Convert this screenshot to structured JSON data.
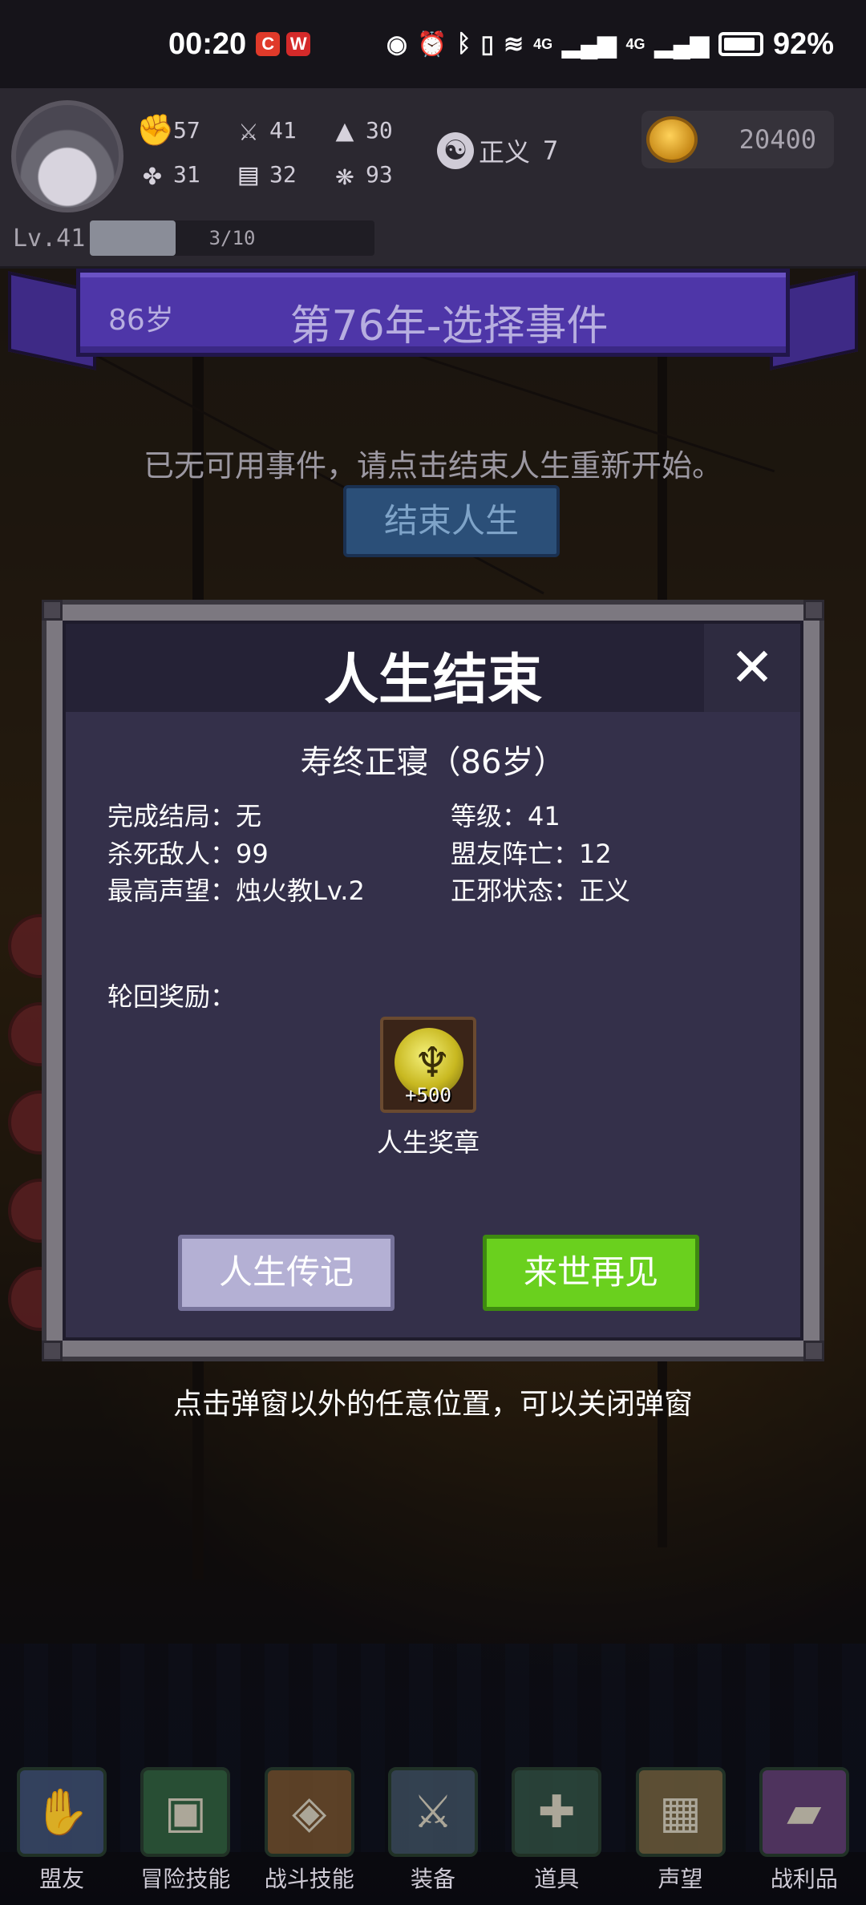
{
  "statusbar": {
    "time": "00:20",
    "badge1": "C",
    "badge2": "W",
    "network1": "4G",
    "network2": "4G",
    "battery_percent": 92,
    "battery_label": "92%"
  },
  "player": {
    "stats": [
      {
        "icon": "fist-icon",
        "glyph": "✊",
        "value": "57"
      },
      {
        "icon": "sword-icon",
        "glyph": "⚔",
        "value": "41"
      },
      {
        "icon": "wizard-hat-icon",
        "glyph": "▲",
        "value": "30"
      },
      {
        "icon": "clover-icon",
        "glyph": "✤",
        "value": "31"
      },
      {
        "icon": "book-icon",
        "glyph": "▤",
        "value": "32"
      },
      {
        "icon": "wings-icon",
        "glyph": "❋",
        "value": "93"
      }
    ],
    "alignment_label": "正义",
    "alignment_value": "7",
    "gold": "20400",
    "level_label": "Lv.41",
    "xp_text": "3/10",
    "xp_fraction": 0.3
  },
  "ribbon": {
    "age": "86岁",
    "title": "第76年-选择事件"
  },
  "main": {
    "no_event_text": "已无可用事件，请点击结束人生重新开始。",
    "end_life_button": "结束人生"
  },
  "modal": {
    "title": "人生结束",
    "close_glyph": "✕",
    "death_text": "寿终正寝（86岁）",
    "info_left": [
      "完成结局：无",
      "杀死敌人：99",
      "最高声望：烛火教Lv.2"
    ],
    "info_right": [
      "等级：41",
      "盟友阵亡：12",
      "正邪状态：正义"
    ],
    "reward_label": "轮回奖励：",
    "reward": {
      "name": "人生奖章",
      "count": "+500"
    },
    "biography_button": "人生传记",
    "next_life_button": "来世再见"
  },
  "hint": "点击弹窗以外的任意位置，可以关闭弹窗",
  "bottom_nav": [
    {
      "label": "盟友",
      "icon": "ally-glove-icon",
      "glyph": "✋"
    },
    {
      "label": "冒险技能",
      "icon": "adventure-book-icon",
      "glyph": "▣"
    },
    {
      "label": "战斗技能",
      "icon": "battle-backpack-icon",
      "glyph": "◈"
    },
    {
      "label": "装备",
      "icon": "equipment-armor-icon",
      "glyph": "⚔"
    },
    {
      "label": "道具",
      "icon": "item-bag-icon",
      "glyph": "✚"
    },
    {
      "label": "声望",
      "icon": "reputation-scroll-icon",
      "glyph": "▦"
    },
    {
      "label": "战利品",
      "icon": "loot-chest-icon",
      "glyph": "▰"
    }
  ]
}
